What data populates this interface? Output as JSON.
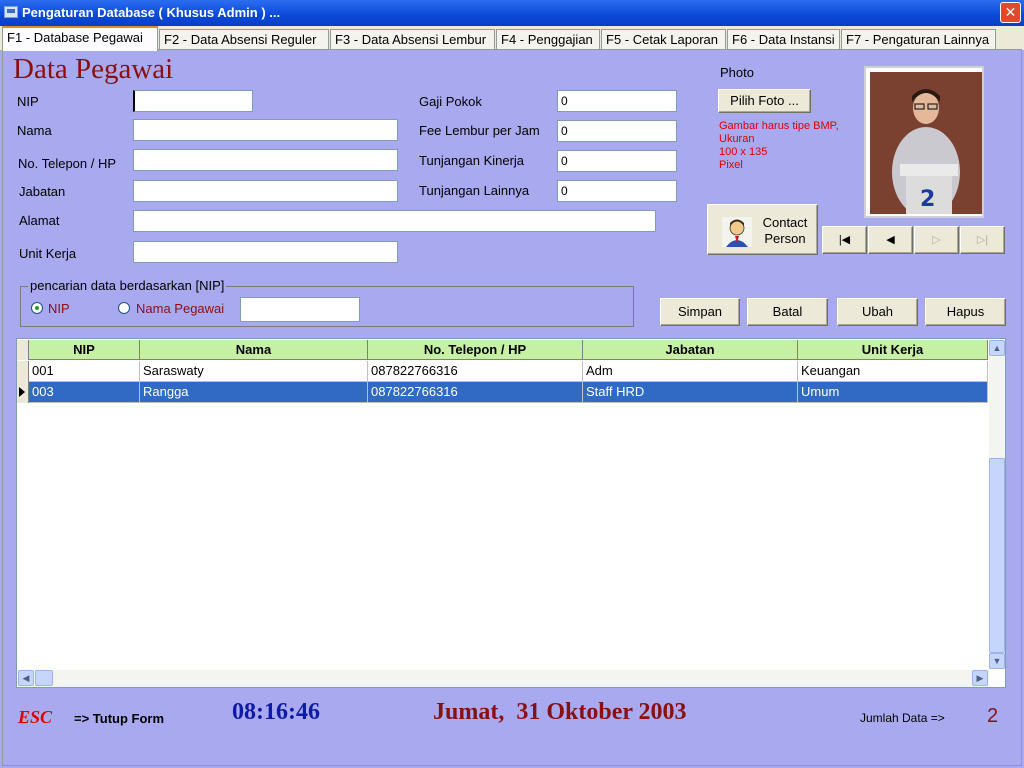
{
  "window": {
    "title": "Pengaturan Database ( Khusus Admin ) ...",
    "close_label": "✕"
  },
  "tabs": [
    {
      "label": "F1 - Database Pegawai"
    },
    {
      "label": "F2 - Data Absensi Reguler"
    },
    {
      "label": "F3 - Data Absensi Lembur"
    },
    {
      "label": "F4 - Penggajian"
    },
    {
      "label": "F5 - Cetak Laporan"
    },
    {
      "label": "F6 - Data Instansi"
    },
    {
      "label": "F7 - Pengaturan Lainnya"
    }
  ],
  "form": {
    "heading": "Data Pegawai",
    "nip": {
      "label": "NIP",
      "value": ""
    },
    "nama": {
      "label": "Nama",
      "value": ""
    },
    "telepon": {
      "label": "No. Telepon / HP",
      "value": ""
    },
    "jabatan": {
      "label": "Jabatan",
      "value": ""
    },
    "alamat": {
      "label": "Alamat",
      "value": ""
    },
    "unit_kerja": {
      "label": "Unit Kerja",
      "value": ""
    },
    "gaji_pokok": {
      "label": "Gaji Pokok",
      "value": "0"
    },
    "fee_lembur": {
      "label": "Fee Lembur per Jam",
      "value": "0"
    },
    "tunjangan_kinerja": {
      "label": "Tunjangan Kinerja",
      "value": "0"
    },
    "tunjangan_lainnya": {
      "label": "Tunjangan Lainnya",
      "value": "0"
    }
  },
  "photo": {
    "label": "Photo",
    "button": "Pilih Foto ...",
    "note": [
      "Gambar harus tipe BMP,",
      "Ukuran",
      "100 x 135",
      "Pixel"
    ],
    "contact_button": "Contact Person"
  },
  "nav_buttons": [
    "first",
    "previous",
    "next",
    "last"
  ],
  "search": {
    "legend": "pencarian data berdasarkan [NIP]",
    "option_nip": "NIP",
    "option_nama": "Nama Pegawai",
    "selected": "NIP",
    "value": ""
  },
  "actions": {
    "simpan": "Simpan",
    "batal": "Batal",
    "ubah": "Ubah",
    "hapus": "Hapus"
  },
  "table": {
    "columns": [
      "NIP",
      "Nama",
      "No. Telepon / HP",
      "Jabatan",
      "Unit Kerja"
    ],
    "rows": [
      [
        "001",
        "Saraswaty",
        "087822766316",
        "Adm",
        "Keuangan"
      ],
      [
        "003",
        "Rangga",
        "087822766316",
        "Staff HRD",
        "Umum"
      ]
    ],
    "selected_row": 1
  },
  "footer": {
    "esc": "ESC",
    "esc_text": "=> Tutup Form",
    "time": "08:16:46",
    "date": "Jumat,  31 Oktober 2003",
    "count_label": "Jumlah Data =>",
    "count": "2"
  },
  "colors": {
    "accent_red": "#8a1010",
    "clock_blue": "#0c1aa8",
    "grid_header": "#c6f0a4",
    "selection": "#316ac5",
    "background": "#a9a9f0"
  }
}
